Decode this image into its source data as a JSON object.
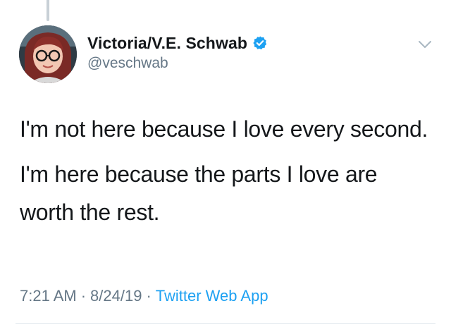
{
  "user": {
    "display_name": "Victoria/V.E. Schwab",
    "handle": "@veschwab",
    "verified": true
  },
  "tweet": {
    "paragraphs": [
      "I'm not here because I love every second.",
      "I'm here because the parts I love are worth the rest."
    ],
    "time": "7:21 AM",
    "date": "8/24/19",
    "separator": "·",
    "source": "Twitter Web App"
  },
  "icons": {
    "verified": "verified-badge-icon",
    "menu": "chevron-down-icon"
  },
  "colors": {
    "text": "#14171a",
    "secondary": "#657786",
    "accent": "#1da1f2",
    "divider": "#e1e8ed"
  }
}
